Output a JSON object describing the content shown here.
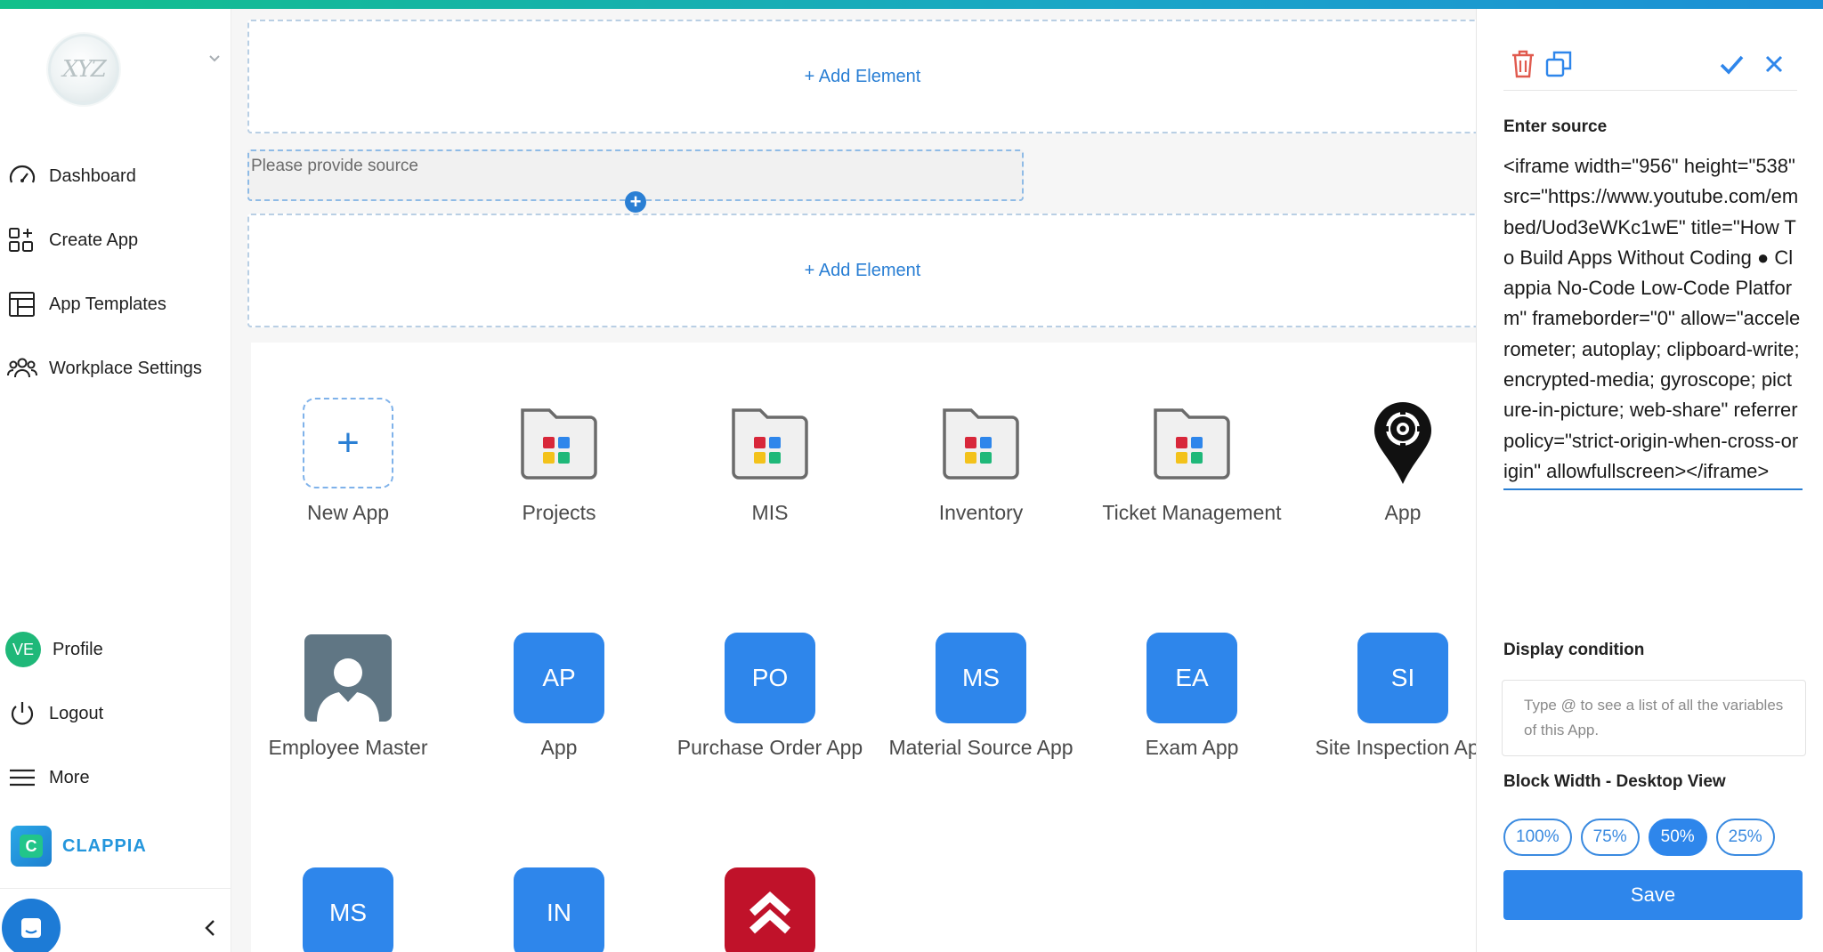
{
  "sidebar": {
    "logo_text": "XYZ",
    "items": [
      {
        "label": "Dashboard",
        "icon": "gauge-icon"
      },
      {
        "label": "Create App",
        "icon": "create-app-icon"
      },
      {
        "label": "App Templates",
        "icon": "templates-icon"
      },
      {
        "label": "Workplace Settings",
        "icon": "people-icon"
      }
    ],
    "profile": {
      "initials": "VE",
      "label": "Profile"
    },
    "logout_label": "Logout",
    "more_label": "More",
    "brand": {
      "name": "CLAPPIA",
      "mark": "C"
    }
  },
  "main": {
    "add_element_label": "+ Add Element",
    "source_placeholder": "Please provide source",
    "plus_handle": "+"
  },
  "apps": [
    {
      "name": "New App",
      "kind": "new"
    },
    {
      "name": "Projects",
      "kind": "folder"
    },
    {
      "name": "MIS",
      "kind": "folder"
    },
    {
      "name": "Inventory",
      "kind": "folder"
    },
    {
      "name": "Ticket Management",
      "kind": "folder"
    },
    {
      "name": "App",
      "kind": "pin"
    },
    {
      "name": "Employee Master",
      "kind": "person"
    },
    {
      "name": "App",
      "kind": "blue",
      "abbr": "AP"
    },
    {
      "name": "Purchase Order App",
      "kind": "blue",
      "abbr": "PO"
    },
    {
      "name": "Material Source App",
      "kind": "blue",
      "abbr": "MS"
    },
    {
      "name": "Exam App",
      "kind": "blue",
      "abbr": "EA"
    },
    {
      "name": "Site Inspection App",
      "kind": "blue",
      "abbr": "SI"
    },
    {
      "name": "",
      "kind": "blue",
      "abbr": "MS"
    },
    {
      "name": "",
      "kind": "blue",
      "abbr": "IN"
    },
    {
      "name": "",
      "kind": "red"
    }
  ],
  "panel": {
    "enter_source_label": "Enter source",
    "source_value": "<iframe width=\"956\" height=\"538\" src=\"https://www.youtube.com/embed/Uod3eWKc1wE\" title=\"How To Build Apps Without Coding ● Clappia No-Code Low-Code Platform\" frameborder=\"0\" allow=\"accelerometer; autoplay; clipboard-write; encrypted-media; gyroscope; picture-in-picture; web-share\" referrerpolicy=\"strict-origin-when-cross-origin\" allowfullscreen></iframe>",
    "display_condition_label": "Display condition",
    "display_condition_placeholder": "Type @ to see a list of all the variables of this App.",
    "block_width_label": "Block Width - Desktop View",
    "width_options": [
      "100%",
      "75%",
      "50%",
      "25%"
    ],
    "selected_width": "50%",
    "save_label": "Save"
  },
  "colors": {
    "accent": "#2e86eb",
    "delete": "#e05a4e",
    "brand_green": "#1fb879",
    "app_red": "#c0122a"
  }
}
